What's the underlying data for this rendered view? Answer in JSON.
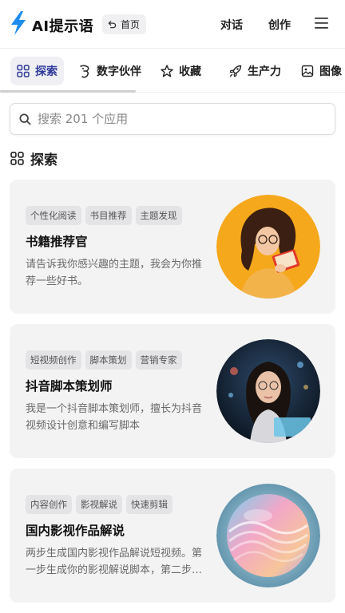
{
  "header": {
    "brand": "AI提示语",
    "home_label": "首页",
    "nav": [
      "对话",
      "创作"
    ]
  },
  "tabs": [
    {
      "label": "探索",
      "icon": "grid-icon",
      "active": true
    },
    {
      "label": "数字伙伴",
      "icon": "character-icon",
      "active": false
    },
    {
      "label": "收藏",
      "icon": "star-icon",
      "active": false
    },
    {
      "label": "生产力",
      "icon": "rocket-icon",
      "active": false
    },
    {
      "label": "图像",
      "icon": "image-icon",
      "active": false
    }
  ],
  "search": {
    "placeholder": "搜索 201 个应用"
  },
  "section": {
    "title": "探索"
  },
  "cards": [
    {
      "tags": [
        "个性化阅读",
        "书目推荐",
        "主题发现"
      ],
      "title": "书籍推荐官",
      "desc": "请告诉我你感兴趣的主题，我会为你推荐一些好书。"
    },
    {
      "tags": [
        "短视频创作",
        "脚本策划",
        "营销专家"
      ],
      "title": "抖音脚本策划师",
      "desc": "我是一个抖音脚本策划师，擅长为抖音视频设计创意和编写脚本"
    },
    {
      "tags": [
        "内容创作",
        "影视解说",
        "快速剪辑"
      ],
      "title": "国内影视作品解说",
      "desc": "两步生成国内影视作品解说短视频。第一步生成你的影视解说脚本，第二步生成视频"
    }
  ],
  "colors": {
    "brand_blue": "#1f8cf0",
    "active_tab_text": "#2f3a9a",
    "card_bg": "#f3f3f4"
  }
}
